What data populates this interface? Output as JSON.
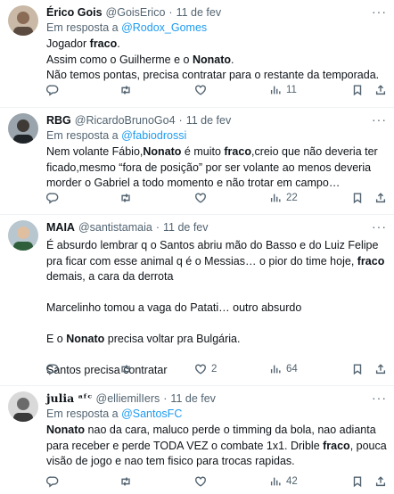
{
  "tweets": [
    {
      "name": "Érico Gois",
      "handle": "@GoisErico",
      "dot": "·",
      "date": "11 de fev",
      "more": "···",
      "reply_prefix": "Em resposta a ",
      "reply_to": "@Rodox_Gomes",
      "body": [
        [
          {
            "t": "Jogador "
          },
          {
            "t": "fraco",
            "b": true
          },
          {
            "t": "."
          }
        ],
        [
          {
            "t": "Assim como o Guilherme e o "
          },
          {
            "t": "Nonato",
            "b": true
          },
          {
            "t": "."
          }
        ],
        [
          {
            "t": "Não temos pontas, precisa contratar para o restante da temporada."
          }
        ]
      ],
      "stats": {
        "replies": "",
        "retweets": "",
        "likes": "",
        "views": "11"
      }
    },
    {
      "name": "RBG",
      "handle": "@RicardoBrunoGo4",
      "dot": "·",
      "date": "11 de fev",
      "more": "···",
      "reply_prefix": "Em resposta a ",
      "reply_to": "@fabiodrossi",
      "body": [
        [
          {
            "t": "Nem volante Fábio,"
          },
          {
            "t": "Nonato",
            "b": true
          },
          {
            "t": " é muito "
          },
          {
            "t": "fraco",
            "b": true
          },
          {
            "t": ",creio que não deveria ter ficado,mesmo “fora de posição” por ser volante ao menos deveria morder o Gabriel a todo momento e não trotar em campo…"
          }
        ]
      ],
      "stats": {
        "replies": "",
        "retweets": "",
        "likes": "",
        "views": "22"
      }
    },
    {
      "name": "MAIA",
      "handle": "@santistamaia",
      "dot": "·",
      "date": "11 de fev",
      "more": "···",
      "reply_prefix": "",
      "reply_to": "",
      "body": [
        [
          {
            "t": "É absurdo lembrar q o Santos abriu mão do Basso e do Luiz Felipe pra ficar com esse animal q é o Messias… o pior do time hoje, "
          },
          {
            "t": "fraco",
            "b": true
          },
          {
            "t": " demais, a cara da derrota"
          }
        ],
        [
          {
            "t": ""
          }
        ],
        [
          {
            "t": "Marcelinho tomou a vaga do Patati… outro absurdo"
          }
        ],
        [
          {
            "t": ""
          }
        ],
        [
          {
            "t": "E o "
          },
          {
            "t": "Nonato",
            "b": true
          },
          {
            "t": " precisa voltar pra Bulgária."
          }
        ],
        [
          {
            "t": ""
          }
        ],
        [
          {
            "t": "Santos precisa contratar"
          }
        ]
      ],
      "stats": {
        "replies": "",
        "retweets": "",
        "likes": "2",
        "views": "64"
      }
    },
    {
      "name": "julia ᵃᶠᶜ",
      "handle": "@elliemilIers",
      "dot": "·",
      "date": "11 de fev",
      "more": "···",
      "reply_prefix": "Em resposta a ",
      "reply_to": "@SantosFC",
      "body": [
        [
          {
            "t": "Nonato",
            "b": true
          },
          {
            "t": " nao da cara, maluco perde o timming da bola, nao adianta para receber e perde TODA VEZ o combate 1x1. Drible "
          },
          {
            "t": "fraco",
            "b": true
          },
          {
            "t": ", pouca visão de jogo e nao tem fisico para trocas rapidas."
          }
        ]
      ],
      "stats": {
        "replies": "",
        "retweets": "",
        "likes": "",
        "views": "42"
      }
    }
  ],
  "colors": {
    "text": "#0f1419",
    "muted": "#536471",
    "link": "#1d9bf0",
    "border": "#eff3f4"
  },
  "icons": [
    "reply-icon",
    "retweet-icon",
    "like-icon",
    "views-icon",
    "bookmark-icon",
    "share-icon",
    "more-icon"
  ]
}
